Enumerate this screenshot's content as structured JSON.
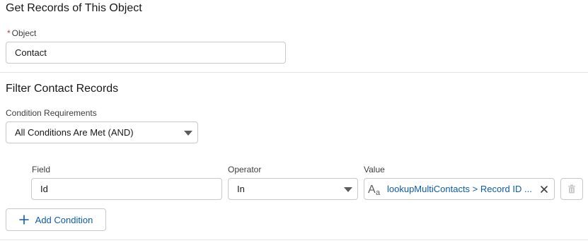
{
  "object_section": {
    "title": "Get Records of This Object",
    "required_marker": "*",
    "object_label": "Object",
    "object_value": "Contact"
  },
  "filter_section": {
    "title": "Filter Contact Records",
    "condition_label": "Condition Requirements",
    "condition_value": "All Conditions Are Met (AND)",
    "columns": {
      "field": "Field",
      "operator": "Operator",
      "value": "Value"
    },
    "row": {
      "field": "Id",
      "operator": "In",
      "value": "lookupMultiContacts > Record ID ..."
    },
    "add_condition_label": "Add Condition"
  }
}
